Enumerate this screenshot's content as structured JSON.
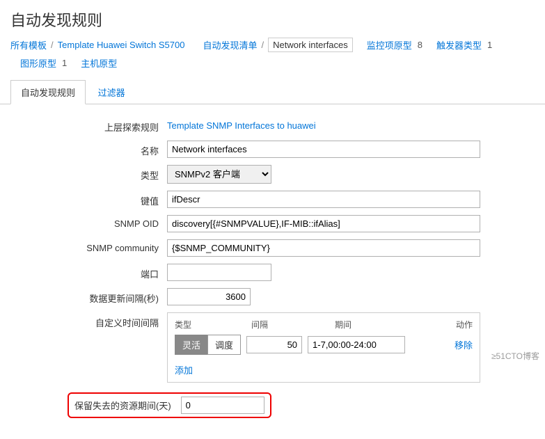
{
  "page_title": "自动发现规则",
  "breadcrumb": {
    "all_templates": "所有模板",
    "template_name": "Template Huawei Switch S5700",
    "discovery_list": "自动发现清单",
    "current": "Network interfaces"
  },
  "stats": {
    "monitor_proto_label": "监控项原型",
    "monitor_proto_count": "8",
    "trigger_proto_label": "触发器类型",
    "trigger_proto_count": "1",
    "graph_proto_label": "图形原型",
    "graph_proto_count": "1",
    "host_proto_label": "主机原型"
  },
  "tabs": {
    "rule": "自动发现规则",
    "filter": "过滤器"
  },
  "form": {
    "parent_label": "上层探索规则",
    "parent_value": "Template SNMP Interfaces to huawei",
    "name_label": "名称",
    "name_value": "Network interfaces",
    "type_label": "类型",
    "type_value": "SNMPv2 客户端",
    "key_label": "键值",
    "key_value": "ifDescr",
    "oid_label": "SNMP OID",
    "oid_value": "discovery[{#SNMPVALUE},IF-MIB::ifAlias]",
    "community_label": "SNMP community",
    "community_value": "{$SNMP_COMMUNITY}",
    "port_label": "端口",
    "port_value": "",
    "update_interval_label": "数据更新间隔(秒)",
    "update_interval_value": "3600",
    "custom_interval_label": "自定义时间间隔",
    "keep_lost_label": "保留失去的资源期间(天)",
    "keep_lost_value": "0"
  },
  "interval_table": {
    "header_type": "类型",
    "header_interval": "间隔",
    "header_period": "期间",
    "header_action": "动作",
    "flex_label": "灵活",
    "sched_label": "调度",
    "interval_value": "50",
    "period_value": "1-7,00:00-24:00",
    "remove_label": "移除",
    "add_label": "添加"
  },
  "watermark": "≥51CTO博客"
}
